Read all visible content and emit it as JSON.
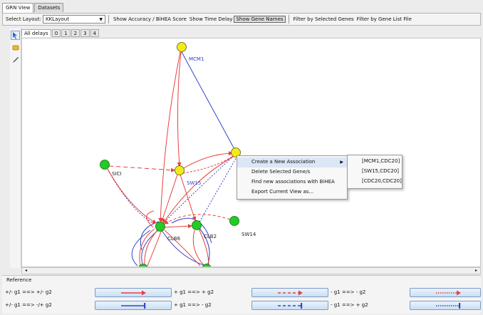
{
  "tabs": [
    {
      "label": "GRN View",
      "active": true
    },
    {
      "label": "Datasets",
      "active": false
    }
  ],
  "toolbar": {
    "layout_label": "Select Layout:",
    "layout_value": "KKLayout",
    "show_accuracy": "Show Accuracy / BiHEA Score",
    "show_time_delay": "Show Time Delay",
    "show_gene_names": "Show Gene Names",
    "filter_selected": "Filter by Selected Genes",
    "filter_file": "Filter by Gene List File"
  },
  "delay_tabs": [
    "All delays",
    "0",
    "1",
    "2",
    "3",
    "4"
  ],
  "graph": {
    "node_colors": {
      "selected": "#f2ea1a",
      "normal": "#22cc22"
    },
    "edge_colors": {
      "activation": "#e8413c",
      "inhibition": "#3546c8"
    },
    "nodes": [
      {
        "id": "MCM1",
        "label": "MCM1",
        "label_color": "#2f3ad1"
      },
      {
        "id": "CDC20",
        "label": ""
      },
      {
        "id": "SICI",
        "label": "SICI",
        "label_color": "#222222"
      },
      {
        "id": "SW15",
        "label": "SW15",
        "label_color": "#2f3ad1"
      },
      {
        "id": "SW14",
        "label": "SW14",
        "label_color": "#222222"
      },
      {
        "id": "CLB6",
        "label": "CLB6",
        "label_color": "#222222"
      },
      {
        "id": "CLB2",
        "label": "CLB2",
        "label_color": "#222222"
      }
    ]
  },
  "context_menu": {
    "items": [
      {
        "label": "Create a New Association",
        "has_submenu": true
      },
      {
        "label": "Delete Selected Gene/s"
      },
      {
        "label": "Find new associations with BiHEA"
      },
      {
        "label": "Export Current View as..."
      }
    ],
    "submenu": [
      "[MCM1,CDC20]",
      "[SW15,CDC20]",
      "[CDC20,CDC20]"
    ]
  },
  "reference": {
    "title": "Reference",
    "items": [
      {
        "text": "+/- g1 ==> +/- g2"
      },
      {
        "text": "+ g1 ==> + g2"
      },
      {
        "text": "- g1 ==> - g2"
      },
      {
        "text": "+/- g1 ==> -/+ g2"
      },
      {
        "text": "+ g1 ==> - g2"
      },
      {
        "text": "- g1 ==> + g2"
      }
    ]
  }
}
